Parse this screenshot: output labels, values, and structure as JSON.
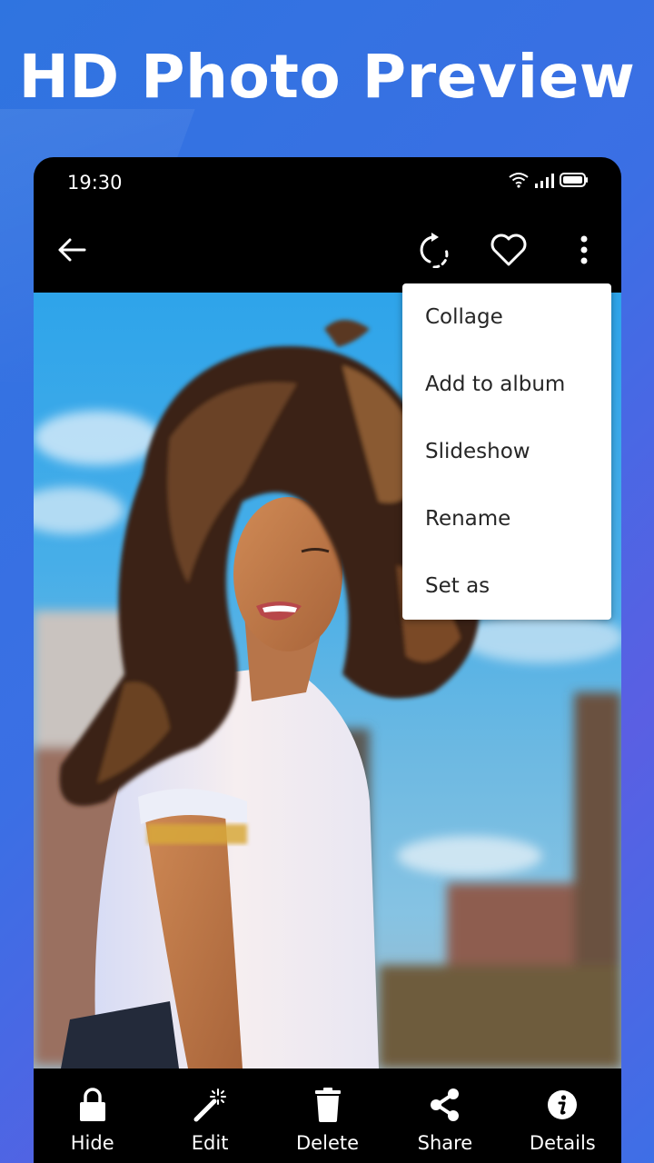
{
  "promo": {
    "headline": "HD Photo Preview"
  },
  "status_bar": {
    "time": "19:30",
    "icons": [
      "wifi-icon",
      "signal-icon",
      "battery-icon"
    ]
  },
  "toolbar": {
    "back": "arrow-left-icon",
    "actions": [
      "rotate-icon",
      "heart-icon",
      "more-vert-icon"
    ]
  },
  "overflow_menu": {
    "items": [
      {
        "label": "Collage"
      },
      {
        "label": "Add to album"
      },
      {
        "label": "Slideshow"
      },
      {
        "label": "Rename"
      },
      {
        "label": "Set as"
      }
    ]
  },
  "photo": {
    "subject": "woman with windblown curly hair in white t-shirt, city buildings and blue sky background"
  },
  "bottom_bar": {
    "items": [
      {
        "label": "Hide",
        "icon": "lock-icon"
      },
      {
        "label": "Edit",
        "icon": "magic-wand-icon"
      },
      {
        "label": "Delete",
        "icon": "trash-icon"
      },
      {
        "label": "Share",
        "icon": "share-icon"
      },
      {
        "label": "Details",
        "icon": "info-icon"
      }
    ]
  },
  "colors": {
    "background_start": "#2f74e0",
    "background_end": "#5a5fe3",
    "bars": "#000000",
    "menu_bg": "#ffffff",
    "menu_text": "#262626"
  }
}
